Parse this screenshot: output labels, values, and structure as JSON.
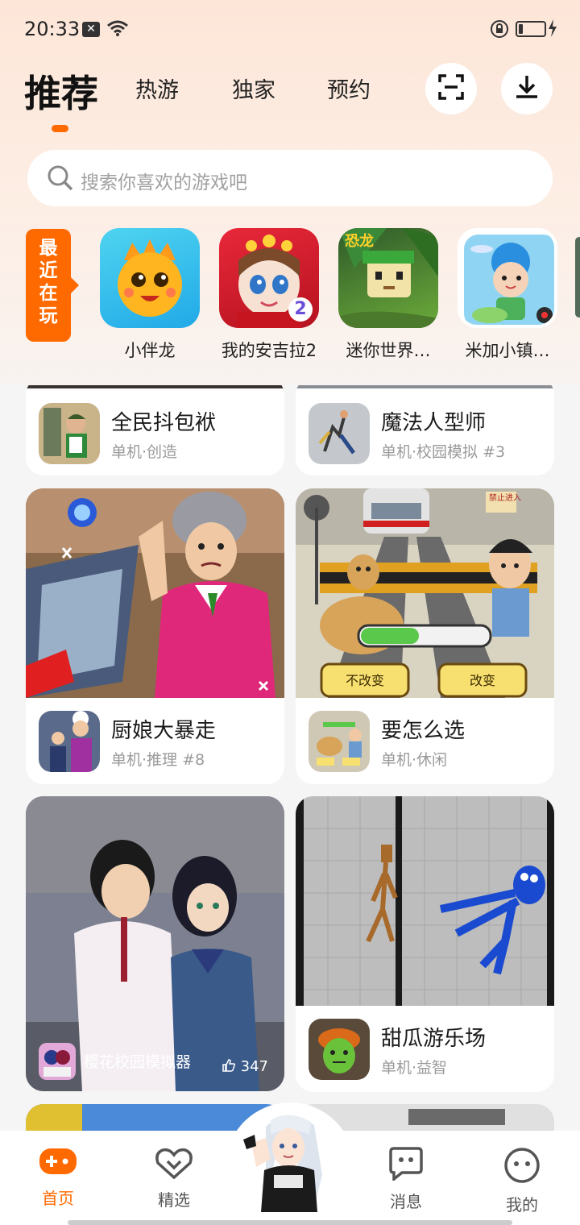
{
  "status_bar": {
    "time": "20:33",
    "notif_icon_text": "✕"
  },
  "header": {
    "tabs": [
      {
        "label": "推荐",
        "active": true
      },
      {
        "label": "热游"
      },
      {
        "label": "独家"
      },
      {
        "label": "预约"
      }
    ],
    "accent_color": "#ff6a00"
  },
  "search": {
    "placeholder": "搜索你喜欢的游戏吧"
  },
  "recent": {
    "badge_chars": [
      "最",
      "近",
      "在",
      "玩"
    ],
    "games": [
      {
        "name": "小伴龙"
      },
      {
        "name": "我的安吉拉2",
        "badge": "2"
      },
      {
        "name": "迷你世界…"
      },
      {
        "name": "米加小镇…"
      }
    ]
  },
  "feed": {
    "cards": [
      {
        "title": "全民抖包袱",
        "sub": "单机·创造"
      },
      {
        "title": "魔法人型师",
        "sub": "单机·校园模拟 #3"
      },
      {
        "title": "厨娘大暴走",
        "sub": "单机·推理 #8"
      },
      {
        "title": "要怎么选",
        "sub": "单机·休闲",
        "img_btn_left": "不改变",
        "img_btn_right": "改变",
        "img_sign": "禁止进入"
      },
      {
        "title": "樱花校园模拟器",
        "likes": "347"
      },
      {
        "title": "甜瓜游乐场",
        "sub": "单机·益智"
      }
    ]
  },
  "bottom_nav": [
    {
      "label": "首页",
      "icon": "gamepad-icon",
      "active": true
    },
    {
      "label": "精选",
      "icon": "heart-badge-icon"
    },
    {
      "label": "消息",
      "icon": "message-icon"
    },
    {
      "label": "我的",
      "icon": "face-icon"
    }
  ]
}
